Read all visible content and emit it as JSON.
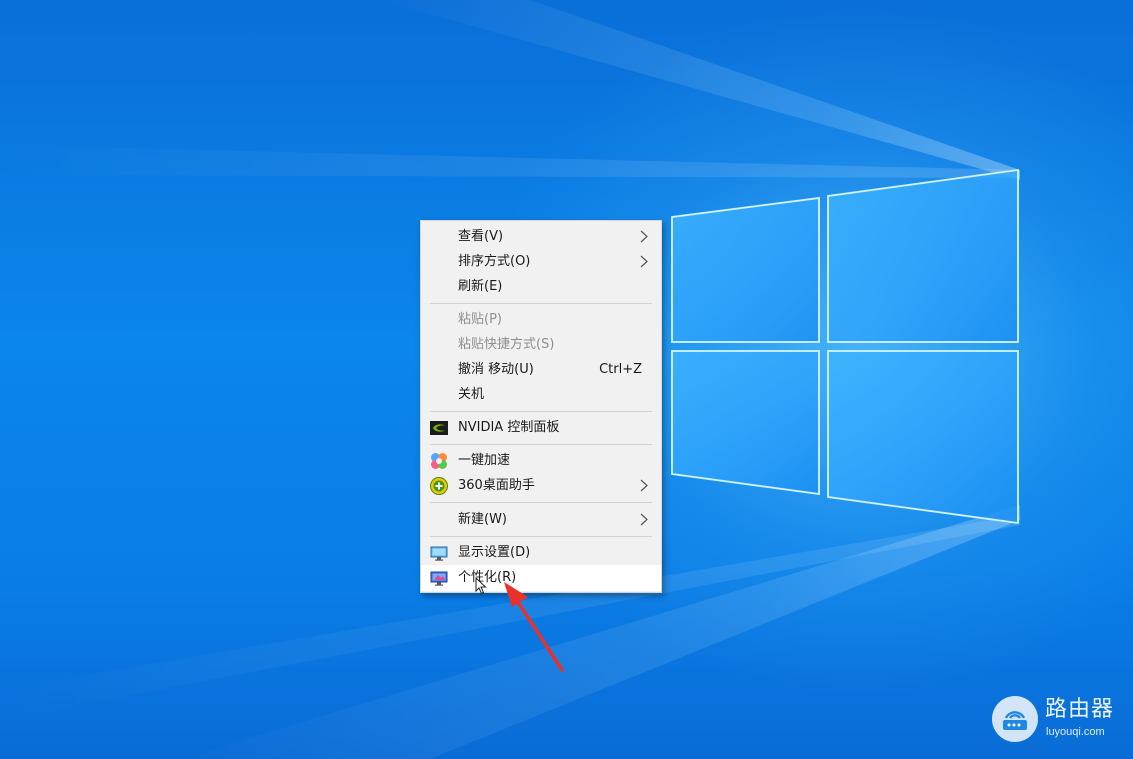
{
  "context_menu": {
    "items": [
      {
        "label": "查看(V)",
        "has_submenu": true
      },
      {
        "label": "排序方式(O)",
        "has_submenu": true
      },
      {
        "label": "刷新(E)"
      },
      {
        "label": "粘贴(P)",
        "disabled": true
      },
      {
        "label": "粘贴快捷方式(S)",
        "disabled": true
      },
      {
        "label": "撤消 移动(U)",
        "shortcut": "Ctrl+Z"
      },
      {
        "label": "关机"
      },
      {
        "label": "NVIDIA 控制面板",
        "icon": "nvidia-icon"
      },
      {
        "label": "一键加速",
        "icon": "speed-boost-icon"
      },
      {
        "label": "360桌面助手",
        "icon": "360-assistant-icon",
        "has_submenu": true
      },
      {
        "label": "新建(W)",
        "has_submenu": true
      },
      {
        "label": "显示设置(D)",
        "icon": "display-settings-icon"
      },
      {
        "label": "个性化(R)",
        "icon": "personalize-icon",
        "hovered": true
      }
    ]
  },
  "watermark": {
    "title": "路由器",
    "url": "luyouqi.com",
    "icon": "router-icon"
  },
  "colors": {
    "desktop_blue": "#0a7fe0",
    "menu_background": "#f1f1f1",
    "hover_background": "#ffffff",
    "annotation_red": "#e8312a",
    "disabled_text": "#8f8f8f"
  }
}
